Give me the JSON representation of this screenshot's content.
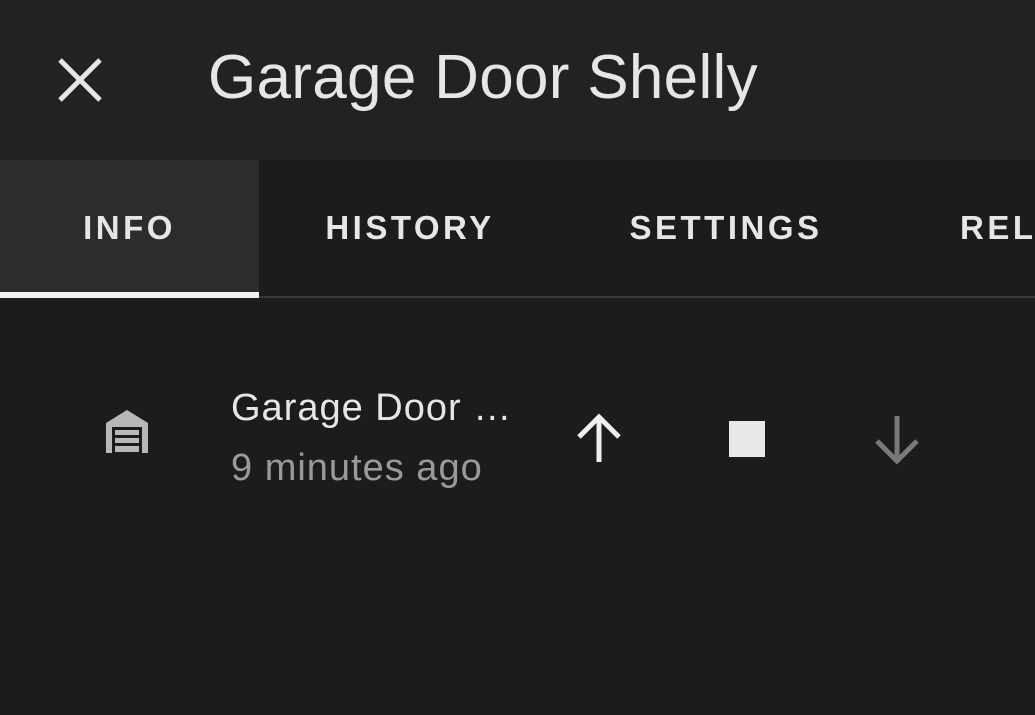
{
  "dialog": {
    "title": "Garage Door Shelly",
    "close_icon": "close-icon"
  },
  "tabs": [
    {
      "label": "INFO",
      "active": true
    },
    {
      "label": "HISTORY",
      "active": false
    },
    {
      "label": "SETTINGS",
      "active": false
    },
    {
      "label": "RELATED",
      "active": false
    }
  ],
  "entity": {
    "icon": "garage-icon",
    "name": "Garage Door …",
    "last_changed": "9 minutes ago",
    "controls": [
      {
        "icon": "arrow-up-icon",
        "enabled": true
      },
      {
        "icon": "stop-icon",
        "enabled": true
      },
      {
        "icon": "arrow-down-icon",
        "enabled": false
      }
    ]
  },
  "colors": {
    "background": "#1c1c1c",
    "header": "#222222",
    "text": "#e6e6e6",
    "secondary_text": "#9a9a9a",
    "disabled_icon": "#7a7a7a"
  }
}
